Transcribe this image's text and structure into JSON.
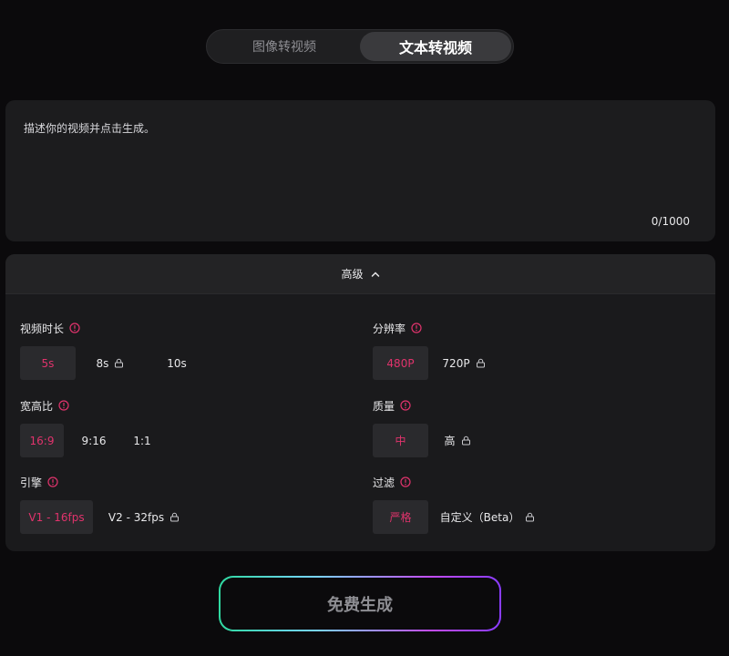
{
  "mode_switch": {
    "tabs": [
      {
        "label": "图像转视频"
      },
      {
        "label": "文本转视频"
      }
    ],
    "active": "文本转视频"
  },
  "prompt": {
    "placeholder": "描述你的视频并点击生成。",
    "value": "",
    "char_count": "0/1000"
  },
  "advanced": {
    "label": "高级",
    "duration": {
      "label": "视频时长",
      "options": [
        {
          "label": "5s",
          "selected": true,
          "locked": false
        },
        {
          "label": "8s",
          "selected": false,
          "locked": true
        },
        {
          "label": "10s",
          "selected": false,
          "locked": false
        }
      ]
    },
    "resolution": {
      "label": "分辨率",
      "options": [
        {
          "label": "480P",
          "selected": true,
          "locked": false
        },
        {
          "label": "720P",
          "selected": false,
          "locked": true
        }
      ]
    },
    "aspect": {
      "label": "宽高比",
      "options": [
        {
          "label": "16:9",
          "selected": true,
          "locked": false
        },
        {
          "label": "9:16",
          "selected": false,
          "locked": false
        },
        {
          "label": "1:1",
          "selected": false,
          "locked": false
        }
      ]
    },
    "quality": {
      "label": "质量",
      "options": [
        {
          "label": "中",
          "selected": true,
          "locked": false
        },
        {
          "label": "高",
          "selected": false,
          "locked": true
        }
      ]
    },
    "engine": {
      "label": "引擎",
      "options": [
        {
          "label": "V1 - 16fps",
          "selected": true,
          "locked": false
        },
        {
          "label": "V2 - 32fps",
          "selected": false,
          "locked": true
        }
      ]
    },
    "filter": {
      "label": "过滤",
      "options": [
        {
          "label": "严格",
          "selected": true,
          "locked": false
        },
        {
          "label": "自定义（Beta）",
          "selected": false,
          "locked": true
        }
      ]
    }
  },
  "generate": {
    "label": "免费生成"
  },
  "colors": {
    "accent": "#e0336c",
    "panel": "#1a1a1c",
    "background": "#0b0a0c"
  },
  "icons": {
    "info": "info-circle-icon",
    "lock": "lock-icon",
    "chevron": "chevron-up-icon"
  }
}
